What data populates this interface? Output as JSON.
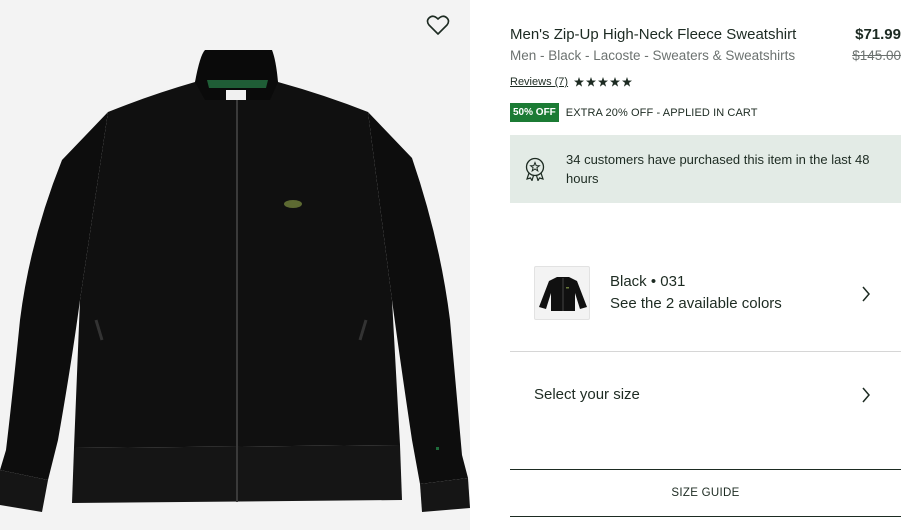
{
  "product": {
    "title": "Men's Zip-Up High-Neck Fleece Sweatshirt",
    "breadcrumb": "Men - Black - Lacoste - Sweaters & Sweatshirts",
    "price": "$71.99",
    "original_price": "$145.00",
    "reviews_label": "Reviews (7)",
    "rating": 5,
    "discount_badge": "50% OFF",
    "promo_text": "EXTRA 20% OFF - APPLIED IN CART",
    "purchase_notice": "34 customers have purchased this item in the last 48 hours"
  },
  "color": {
    "name": "Black • 031",
    "link": "See the 2 available colors"
  },
  "size": {
    "label": "Select your size"
  },
  "size_guide": "SIZE GUIDE",
  "icons": {
    "wishlist": "heart-outline-icon",
    "purchase": "award-badge-icon",
    "star": "star-icon",
    "chevron": "chevron-right-icon"
  },
  "colors": {
    "accent": "#1b7b34",
    "notice_bg": "#e3ebe6",
    "text": "#1d2b22"
  }
}
